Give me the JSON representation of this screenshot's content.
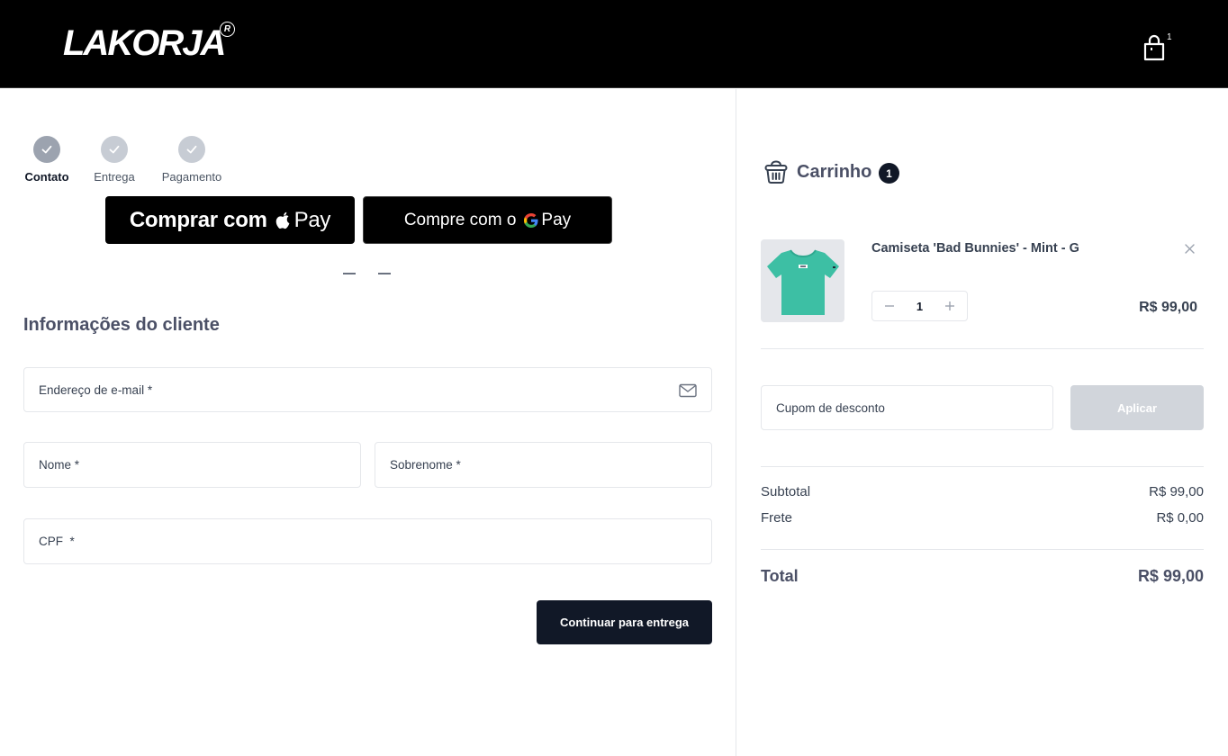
{
  "header": {
    "logo": "LAKORJA",
    "logo_mark": "R",
    "cart_count": "1",
    "icons": {
      "cart": "shopping-bag-icon"
    }
  },
  "steps": [
    {
      "label": "Contato",
      "active": true
    },
    {
      "label": "Entrega",
      "active": false
    },
    {
      "label": "Pagamento",
      "active": false
    }
  ],
  "express": {
    "apple_pay_prefix": "Comprar com",
    "apple_pay_suffix": "Pay",
    "google_pay_prefix": "Compre com o",
    "google_pay_suffix": "Pay"
  },
  "customer": {
    "title": "Informações do cliente",
    "email_placeholder": "Endereço de e-mail *",
    "first_name_placeholder": "Nome *",
    "last_name_placeholder": "Sobrenome *",
    "cpf_placeholder": "CPF  *",
    "continue_label": "Continuar para entrega"
  },
  "cart": {
    "title": "Carrinho",
    "badge": "1",
    "items": [
      {
        "name": "Camiseta 'Bad Bunnies' - Mint - G",
        "quantity": "1",
        "price": "R$ 99,00",
        "image_alt": "mint t-shirt"
      }
    ],
    "coupon_placeholder": "Cupom de desconto",
    "apply_label": "Aplicar",
    "subtotal_label": "Subtotal",
    "subtotal_value": "R$ 99,00",
    "shipping_label": "Frete",
    "shipping_value": "R$ 0,00",
    "total_label": "Total",
    "total_value": "R$ 99,00"
  },
  "colors": {
    "header_bg": "#000000",
    "step_done": "#9ca3af",
    "primary_button": "#111827",
    "disabled_button": "#d1d5db",
    "shirt": "#3dbfa4"
  }
}
